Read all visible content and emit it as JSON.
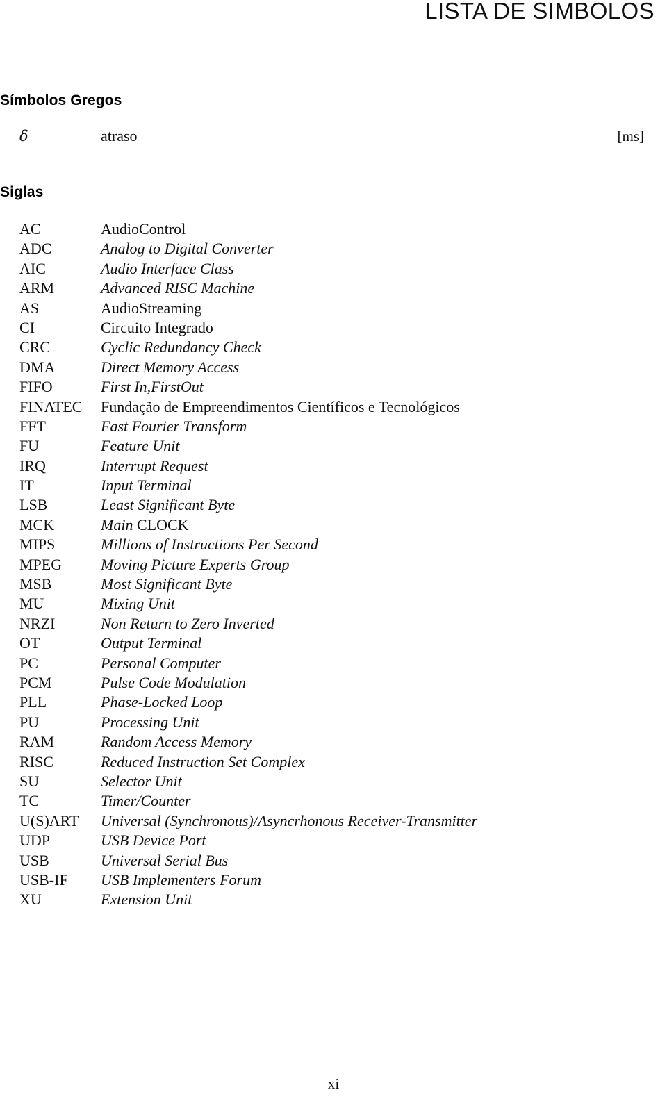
{
  "page": {
    "running_head": "LISTA DE SIMBOLOS",
    "folio": "xi"
  },
  "greek_section": {
    "heading": "Símbolos Gregos",
    "entries": [
      {
        "symbol": "δ",
        "description": "atraso",
        "unit": "[ms]"
      }
    ]
  },
  "acronym_section": {
    "heading": "Siglas",
    "entries": [
      {
        "abbr": "AC",
        "desc": "AudioControl",
        "style": "roman"
      },
      {
        "abbr": "ADC",
        "desc": "Analog to Digital Converter",
        "style": "italic"
      },
      {
        "abbr": "AIC",
        "desc": "Audio Interface Class",
        "style": "italic"
      },
      {
        "abbr": "ARM",
        "desc": "Advanced RISC Machine",
        "style": "italic"
      },
      {
        "abbr": "AS",
        "desc": "AudioStreaming",
        "style": "roman"
      },
      {
        "abbr": "CI",
        "desc": "Circuito Integrado",
        "style": "roman"
      },
      {
        "abbr": "CRC",
        "desc": "Cyclic Redundancy Check",
        "style": "italic"
      },
      {
        "abbr": "DMA",
        "desc": "Direct Memory Access",
        "style": "italic"
      },
      {
        "abbr": "FIFO",
        "desc": "First In,FirstOut",
        "style": "italic"
      },
      {
        "abbr": "FINATEC",
        "desc": "Fundação de Empreendimentos Científicos e Tecnológicos",
        "style": "roman"
      },
      {
        "abbr": "FFT",
        "desc": "Fast Fourier Transform",
        "style": "italic"
      },
      {
        "abbr": "FU",
        "desc": "Feature Unit",
        "style": "italic"
      },
      {
        "abbr": "IRQ",
        "desc": "Interrupt Request",
        "style": "italic"
      },
      {
        "abbr": "IT",
        "desc": "Input Terminal",
        "style": "italic"
      },
      {
        "abbr": "LSB",
        "desc": "Least Significant Byte",
        "style": "italic"
      },
      {
        "abbr": "MCK",
        "desc": "Main CLOCK",
        "style": "mixed",
        "italic_part": "Main ",
        "roman_part": "CLOCK"
      },
      {
        "abbr": "MIPS",
        "desc": "Millions of Instructions Per Second",
        "style": "italic"
      },
      {
        "abbr": "MPEG",
        "desc": "Moving Picture Experts Group",
        "style": "italic"
      },
      {
        "abbr": "MSB",
        "desc": "Most Significant Byte",
        "style": "italic"
      },
      {
        "abbr": "MU",
        "desc": "Mixing Unit",
        "style": "italic"
      },
      {
        "abbr": "NRZI",
        "desc": "Non Return to Zero Inverted",
        "style": "italic"
      },
      {
        "abbr": "OT",
        "desc": "Output Terminal",
        "style": "italic"
      },
      {
        "abbr": "PC",
        "desc": "Personal Computer",
        "style": "italic"
      },
      {
        "abbr": "PCM",
        "desc": "Pulse Code Modulation",
        "style": "italic"
      },
      {
        "abbr": "PLL",
        "desc": "Phase-Locked Loop",
        "style": "italic"
      },
      {
        "abbr": "PU",
        "desc": "Processing Unit",
        "style": "italic"
      },
      {
        "abbr": "RAM",
        "desc": "Random Access Memory",
        "style": "italic"
      },
      {
        "abbr": "RISC",
        "desc": "Reduced Instruction Set Complex",
        "style": "italic"
      },
      {
        "abbr": "SU",
        "desc": "Selector Unit",
        "style": "italic"
      },
      {
        "abbr": "TC",
        "desc": "Timer/Counter",
        "style": "italic"
      },
      {
        "abbr": "U(S)ART",
        "desc": "Universal (Synchronous)/Asyncrhonous Receiver-Transmitter",
        "style": "italic"
      },
      {
        "abbr": "UDP",
        "desc": "USB Device Port",
        "style": "italic"
      },
      {
        "abbr": "USB",
        "desc": "Universal Serial Bus",
        "style": "italic"
      },
      {
        "abbr": "USB-IF",
        "desc": "USB Implementers Forum",
        "style": "italic"
      },
      {
        "abbr": "XU",
        "desc": "Extension Unit",
        "style": "italic"
      }
    ]
  }
}
